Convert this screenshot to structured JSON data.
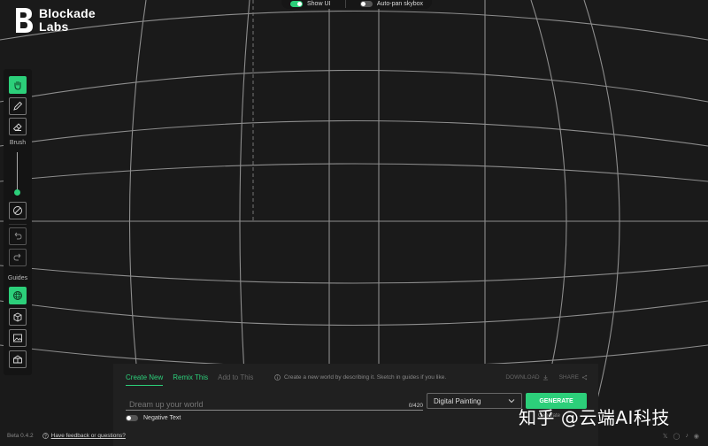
{
  "brand": {
    "line1": "Blockade",
    "line2": "Labs"
  },
  "topbar": {
    "show_ui": {
      "label": "Show UI",
      "on": true
    },
    "auto_pan": {
      "label": "Auto-pan skybox",
      "on": false
    }
  },
  "toolbar": {
    "brush_label": "Brush",
    "guides_label": "Guides",
    "tools": [
      {
        "icon": "hand-icon",
        "active": true
      },
      {
        "icon": "pencil-icon",
        "active": false
      },
      {
        "icon": "eraser-icon",
        "active": false
      },
      {
        "icon": "clear-icon",
        "active": false
      },
      {
        "icon": "undo-icon",
        "active": false
      },
      {
        "icon": "redo-icon",
        "active": false
      },
      {
        "icon": "sphere-guide-icon",
        "active": true
      },
      {
        "icon": "cube-guide-icon",
        "active": false
      },
      {
        "icon": "image-guide-icon",
        "active": false
      },
      {
        "icon": "room-guide-icon",
        "active": false
      }
    ]
  },
  "panel": {
    "tabs": [
      "Create New",
      "Remix This",
      "Add to This"
    ],
    "active_tab": "Create New",
    "hint": "Create a new world by describing it. Sketch in guides if you like.",
    "download": "DOWNLOAD",
    "share": "SHARE",
    "prompt_placeholder": "Dream up your world",
    "counter": "0/420",
    "style": "Digital Painting",
    "generate": "GENERATE",
    "generate_sub": "Generate",
    "negative_text": "Negative Text"
  },
  "footer": {
    "version": "Beta 0.4.2",
    "feedback": "Have feedback or questions?"
  },
  "social": [
    "twitter-icon",
    "instagram-icon",
    "tiktok-icon",
    "discord-icon"
  ],
  "watermark": "知乎 @云端AI科技",
  "colors": {
    "accent": "#2ccf7a",
    "background": "#1a1a1a",
    "grid": "#8a8a8a"
  }
}
